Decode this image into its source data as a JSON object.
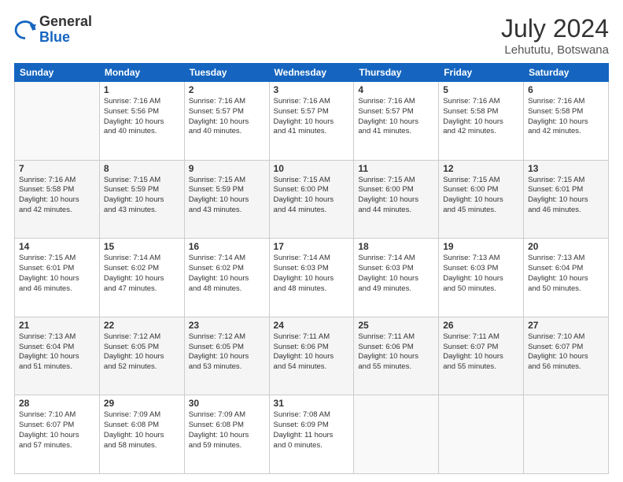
{
  "header": {
    "logo_general": "General",
    "logo_blue": "Blue",
    "month_year": "July 2024",
    "location": "Lehututu, Botswana"
  },
  "days_of_week": [
    "Sunday",
    "Monday",
    "Tuesday",
    "Wednesday",
    "Thursday",
    "Friday",
    "Saturday"
  ],
  "weeks": [
    [
      {
        "day": "",
        "info": ""
      },
      {
        "day": "1",
        "info": "Sunrise: 7:16 AM\nSunset: 5:56 PM\nDaylight: 10 hours\nand 40 minutes."
      },
      {
        "day": "2",
        "info": "Sunrise: 7:16 AM\nSunset: 5:57 PM\nDaylight: 10 hours\nand 40 minutes."
      },
      {
        "day": "3",
        "info": "Sunrise: 7:16 AM\nSunset: 5:57 PM\nDaylight: 10 hours\nand 41 minutes."
      },
      {
        "day": "4",
        "info": "Sunrise: 7:16 AM\nSunset: 5:57 PM\nDaylight: 10 hours\nand 41 minutes."
      },
      {
        "day": "5",
        "info": "Sunrise: 7:16 AM\nSunset: 5:58 PM\nDaylight: 10 hours\nand 42 minutes."
      },
      {
        "day": "6",
        "info": "Sunrise: 7:16 AM\nSunset: 5:58 PM\nDaylight: 10 hours\nand 42 minutes."
      }
    ],
    [
      {
        "day": "7",
        "info": "Sunrise: 7:16 AM\nSunset: 5:58 PM\nDaylight: 10 hours\nand 42 minutes."
      },
      {
        "day": "8",
        "info": "Sunrise: 7:15 AM\nSunset: 5:59 PM\nDaylight: 10 hours\nand 43 minutes."
      },
      {
        "day": "9",
        "info": "Sunrise: 7:15 AM\nSunset: 5:59 PM\nDaylight: 10 hours\nand 43 minutes."
      },
      {
        "day": "10",
        "info": "Sunrise: 7:15 AM\nSunset: 6:00 PM\nDaylight: 10 hours\nand 44 minutes."
      },
      {
        "day": "11",
        "info": "Sunrise: 7:15 AM\nSunset: 6:00 PM\nDaylight: 10 hours\nand 44 minutes."
      },
      {
        "day": "12",
        "info": "Sunrise: 7:15 AM\nSunset: 6:00 PM\nDaylight: 10 hours\nand 45 minutes."
      },
      {
        "day": "13",
        "info": "Sunrise: 7:15 AM\nSunset: 6:01 PM\nDaylight: 10 hours\nand 46 minutes."
      }
    ],
    [
      {
        "day": "14",
        "info": "Sunrise: 7:15 AM\nSunset: 6:01 PM\nDaylight: 10 hours\nand 46 minutes."
      },
      {
        "day": "15",
        "info": "Sunrise: 7:14 AM\nSunset: 6:02 PM\nDaylight: 10 hours\nand 47 minutes."
      },
      {
        "day": "16",
        "info": "Sunrise: 7:14 AM\nSunset: 6:02 PM\nDaylight: 10 hours\nand 48 minutes."
      },
      {
        "day": "17",
        "info": "Sunrise: 7:14 AM\nSunset: 6:03 PM\nDaylight: 10 hours\nand 48 minutes."
      },
      {
        "day": "18",
        "info": "Sunrise: 7:14 AM\nSunset: 6:03 PM\nDaylight: 10 hours\nand 49 minutes."
      },
      {
        "day": "19",
        "info": "Sunrise: 7:13 AM\nSunset: 6:03 PM\nDaylight: 10 hours\nand 50 minutes."
      },
      {
        "day": "20",
        "info": "Sunrise: 7:13 AM\nSunset: 6:04 PM\nDaylight: 10 hours\nand 50 minutes."
      }
    ],
    [
      {
        "day": "21",
        "info": "Sunrise: 7:13 AM\nSunset: 6:04 PM\nDaylight: 10 hours\nand 51 minutes."
      },
      {
        "day": "22",
        "info": "Sunrise: 7:12 AM\nSunset: 6:05 PM\nDaylight: 10 hours\nand 52 minutes."
      },
      {
        "day": "23",
        "info": "Sunrise: 7:12 AM\nSunset: 6:05 PM\nDaylight: 10 hours\nand 53 minutes."
      },
      {
        "day": "24",
        "info": "Sunrise: 7:11 AM\nSunset: 6:06 PM\nDaylight: 10 hours\nand 54 minutes."
      },
      {
        "day": "25",
        "info": "Sunrise: 7:11 AM\nSunset: 6:06 PM\nDaylight: 10 hours\nand 55 minutes."
      },
      {
        "day": "26",
        "info": "Sunrise: 7:11 AM\nSunset: 6:07 PM\nDaylight: 10 hours\nand 55 minutes."
      },
      {
        "day": "27",
        "info": "Sunrise: 7:10 AM\nSunset: 6:07 PM\nDaylight: 10 hours\nand 56 minutes."
      }
    ],
    [
      {
        "day": "28",
        "info": "Sunrise: 7:10 AM\nSunset: 6:07 PM\nDaylight: 10 hours\nand 57 minutes."
      },
      {
        "day": "29",
        "info": "Sunrise: 7:09 AM\nSunset: 6:08 PM\nDaylight: 10 hours\nand 58 minutes."
      },
      {
        "day": "30",
        "info": "Sunrise: 7:09 AM\nSunset: 6:08 PM\nDaylight: 10 hours\nand 59 minutes."
      },
      {
        "day": "31",
        "info": "Sunrise: 7:08 AM\nSunset: 6:09 PM\nDaylight: 11 hours\nand 0 minutes."
      },
      {
        "day": "",
        "info": ""
      },
      {
        "day": "",
        "info": ""
      },
      {
        "day": "",
        "info": ""
      }
    ]
  ]
}
